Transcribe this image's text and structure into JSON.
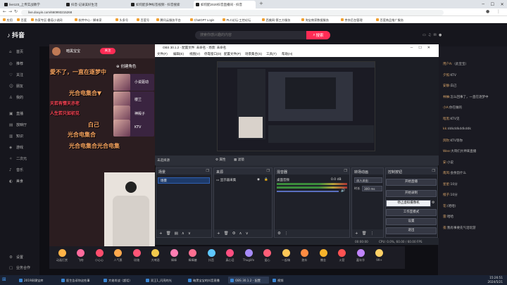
{
  "browser": {
    "tabs": [
      {
        "label": "live123_上传实战教学"
      },
      {
        "label": "抖音-记录美好生活"
      },
      {
        "label": "如何配多种标签视频 - 抖音搜索"
      },
      {
        "label": "如何配2020抖音直播间 - 抖音"
      }
    ],
    "url": "live.douyin.com/660993215268",
    "bookmarks": [
      "应用",
      "百度",
      "作家专区-番茄小说网",
      "软件中心 - 脚本家",
      "头条号",
      "百度号",
      "腾讯云服务平台",
      "ChatGPT Login",
      "PLC论坛-工控论坛",
      "西美网-第三方服务",
      "淘宝商家数据服务",
      "京东后台管理",
      "百度商品推广服务"
    ]
  },
  "douyin": {
    "logo": "抖音",
    "search_placeholder": "搜索你感兴趣的内容",
    "search_label": "搜索",
    "nav": [
      "首页",
      "推荐",
      "关注",
      "朋友",
      "我的",
      "直播",
      "放映厅",
      "知识",
      "游戏",
      "二次元",
      "音乐",
      "美食"
    ],
    "nav_bottom": [
      "设置",
      "业务合作"
    ],
    "streamer": {
      "name": "暗黑宝宝",
      "follow": "关注"
    },
    "overlay": [
      "愛不了，一直在逐梦中",
      "光合电集合▼",
      "白己",
      "光合电集合",
      "光合电集合光合电集"
    ],
    "overlay_red": [
      "天若有情天亦老",
      "人生若只如初见"
    ],
    "chars": [
      {
        "title": "创建角色"
      },
      {
        "name": "小说驱动"
      },
      {
        "name": "楼兰"
      },
      {
        "name": "神殿子"
      },
      {
        "name": "KTV"
      }
    ],
    "gifts": [
      "动画打赏",
      "飞吻",
      "小心心",
      "人气票",
      "玫瑰",
      "大啤酒",
      "棒棒",
      "棒棒糖",
      "抖音",
      "真心话",
      "Thuglife",
      "爱心",
      "一起嗨",
      "跑车",
      "撒金",
      "火箭",
      "嘉年华",
      "99+"
    ],
    "chat": [
      {
        "user": "用户A:",
        "text": "（此宝宝）"
      },
      {
        "user": "夕照:",
        "text": "KTV"
      },
      {
        "user": "安静:",
        "text": "白己"
      },
      {
        "user": "林柚:",
        "text": "怎么回事了，一直在逐梦中"
      },
      {
        "user": "小A:",
        "text": "你在做的"
      },
      {
        "user": "暗黑:",
        "text": "KTV见"
      },
      {
        "user": "kk:",
        "text": "ddkddkddkddk"
      },
      {
        "user": "风吹:",
        "text": "KTV等你"
      },
      {
        "user": "Wee:",
        "text": "大哥们大神来直播"
      },
      {
        "user": "安:",
        "text": "小说"
      },
      {
        "user": "南风:",
        "text": "会余韵什么"
      },
      {
        "user": "星星:",
        "text": "10分"
      },
      {
        "user": "橙子:",
        "text": "10分"
      },
      {
        "user": "花:",
        "text": "(哈哈)"
      },
      {
        "user": "雷:",
        "text": "哈哈"
      },
      {
        "user": "夜:",
        "text": "我有事要先气话玩游"
      }
    ]
  },
  "obs": {
    "title": "OBS 30.1.2 - 配置文件: 未命名 - 场景: 未命名",
    "menu": [
      "文件(F)",
      "编辑(E)",
      "视图(V)",
      "停靠窗口(D)",
      "配置文件(P)",
      "场景集合(S)",
      "工具(T)",
      "帮助(H)"
    ],
    "status_strip": {
      "label": "未选择源",
      "properties": "属性",
      "filters": "滤镜"
    },
    "docks": {
      "scenes": {
        "title": "场景",
        "item": "场景"
      },
      "sources": {
        "title": "来源",
        "item": "显示器采集"
      },
      "mixer": {
        "title": "混音器",
        "track": "桌面音频",
        "db": "0.0 dB"
      },
      "transitions": {
        "title": "转场动画",
        "type": "淡入淡出",
        "duration_label": "时长",
        "duration": "300 ms"
      },
      "controls": {
        "title": "控制按钮",
        "buttons": [
          "开始直播",
          "开始录制",
          "停止虚拟摄像机",
          "工作室模式",
          "设置",
          "退出"
        ]
      }
    },
    "status": "CPU: 0.0%, 60.00 / 60.00 FPS",
    "time": "00:00:00"
  },
  "taskbar": {
    "tasks": [
      "2019网课宝库",
      "医生告诉你这些事",
      "大佬肖战（超话）",
      "双王1_闪亮的光",
      "暗黑宝宝的抖音直播",
      "OBS 30.1.2 - 配置",
      "视频"
    ],
    "time": "15:26:51",
    "date": "2024/5/21"
  },
  "colors": {
    "accent": "#fe2c55",
    "obs_bg": "#272a33",
    "selection": "#1e3b6a"
  }
}
